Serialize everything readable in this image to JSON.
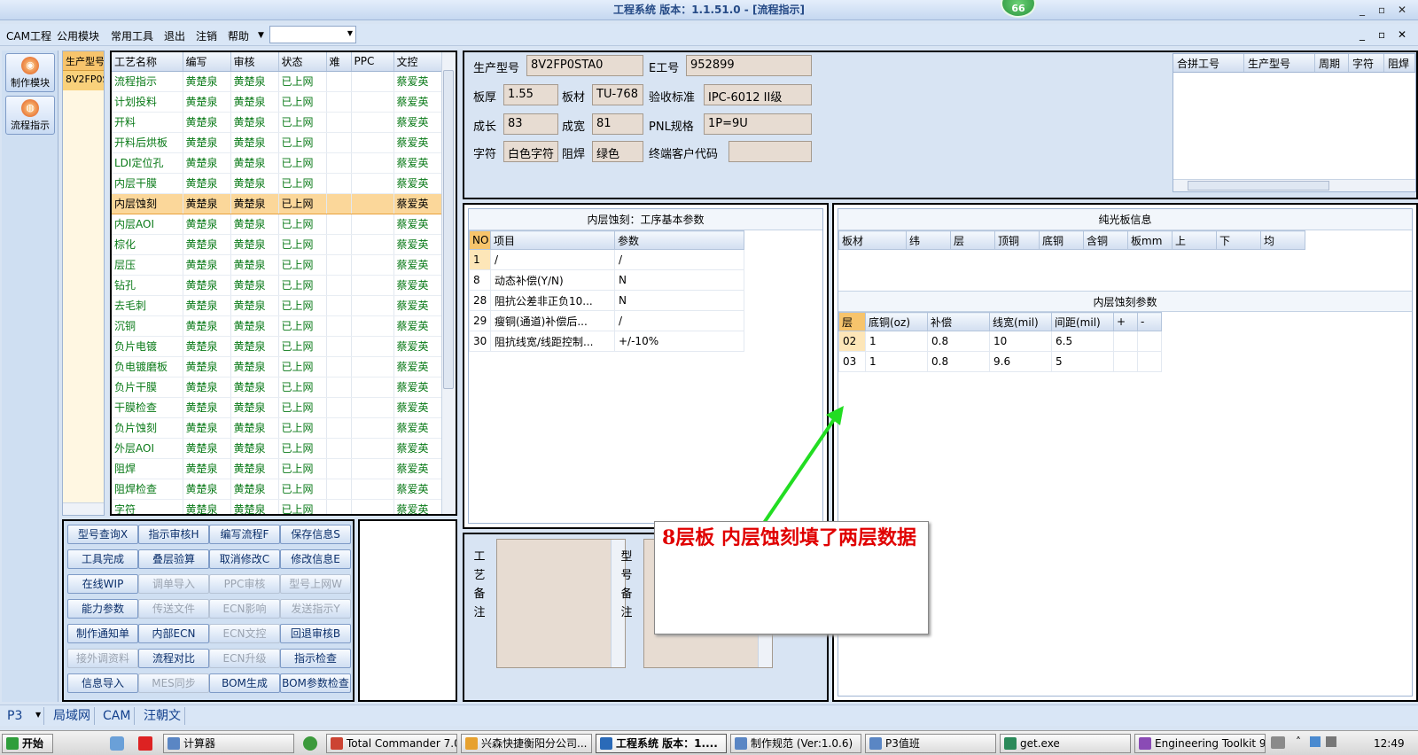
{
  "window": {
    "title": "工程系统   版本：1.1.51.0 - [流程指示]",
    "badge": "66",
    "controls": [
      "_",
      "▫",
      "✕"
    ]
  },
  "menu": {
    "items": [
      "CAM工程",
      "公用模块",
      "常用工具",
      "退出",
      "注销",
      "帮助"
    ],
    "combo_value": ""
  },
  "leftnav": {
    "buttons": [
      "制作模块",
      "流程指示"
    ]
  },
  "model_list": {
    "header": "生产型号",
    "rows": [
      "8V2FP0STA0"
    ]
  },
  "process_grid": {
    "columns": [
      "工艺名称",
      "编写",
      "审核",
      "状态",
      "难",
      "PPC",
      "文控"
    ],
    "rows": [
      [
        "流程指示",
        "黄楚泉",
        "黄楚泉",
        "已上网",
        "",
        "",
        "蔡爱英"
      ],
      [
        "计划投料",
        "黄楚泉",
        "黄楚泉",
        "已上网",
        "",
        "",
        "蔡爱英"
      ],
      [
        "开料",
        "黄楚泉",
        "黄楚泉",
        "已上网",
        "",
        "",
        "蔡爱英"
      ],
      [
        "开料后烘板",
        "黄楚泉",
        "黄楚泉",
        "已上网",
        "",
        "",
        "蔡爱英"
      ],
      [
        "LDI定位孔",
        "黄楚泉",
        "黄楚泉",
        "已上网",
        "",
        "",
        "蔡爱英"
      ],
      [
        "内层干膜",
        "黄楚泉",
        "黄楚泉",
        "已上网",
        "",
        "",
        "蔡爱英"
      ],
      [
        "内层蚀刻",
        "黄楚泉",
        "黄楚泉",
        "已上网",
        "",
        "",
        "蔡爱英"
      ],
      [
        "内层AOI",
        "黄楚泉",
        "黄楚泉",
        "已上网",
        "",
        "",
        "蔡爱英"
      ],
      [
        "棕化",
        "黄楚泉",
        "黄楚泉",
        "已上网",
        "",
        "",
        "蔡爱英"
      ],
      [
        "层压",
        "黄楚泉",
        "黄楚泉",
        "已上网",
        "",
        "",
        "蔡爱英"
      ],
      [
        "钻孔",
        "黄楚泉",
        "黄楚泉",
        "已上网",
        "",
        "",
        "蔡爱英"
      ],
      [
        "去毛刺",
        "黄楚泉",
        "黄楚泉",
        "已上网",
        "",
        "",
        "蔡爱英"
      ],
      [
        "沉铜",
        "黄楚泉",
        "黄楚泉",
        "已上网",
        "",
        "",
        "蔡爱英"
      ],
      [
        "负片电镀",
        "黄楚泉",
        "黄楚泉",
        "已上网",
        "",
        "",
        "蔡爱英"
      ],
      [
        "负电镀磨板",
        "黄楚泉",
        "黄楚泉",
        "已上网",
        "",
        "",
        "蔡爱英"
      ],
      [
        "负片干膜",
        "黄楚泉",
        "黄楚泉",
        "已上网",
        "",
        "",
        "蔡爱英"
      ],
      [
        "干膜检查",
        "黄楚泉",
        "黄楚泉",
        "已上网",
        "",
        "",
        "蔡爱英"
      ],
      [
        "负片蚀刻",
        "黄楚泉",
        "黄楚泉",
        "已上网",
        "",
        "",
        "蔡爱英"
      ],
      [
        "外层AOI",
        "黄楚泉",
        "黄楚泉",
        "已上网",
        "",
        "",
        "蔡爱英"
      ],
      [
        "阻焊",
        "黄楚泉",
        "黄楚泉",
        "已上网",
        "",
        "",
        "蔡爱英"
      ],
      [
        "阻焊检查",
        "黄楚泉",
        "黄楚泉",
        "已上网",
        "",
        "",
        "蔡爱英"
      ],
      [
        "字符",
        "黄楚泉",
        "黄楚泉",
        "已上网",
        "",
        "",
        "蔡爱英"
      ]
    ],
    "selected_row": 6
  },
  "function_buttons": [
    {
      "label": "型号查询X",
      "enabled": true
    },
    {
      "label": "指示审核H",
      "enabled": true
    },
    {
      "label": "编写流程F",
      "enabled": true
    },
    {
      "label": "保存信息S",
      "enabled": true
    },
    {
      "label": "工具完成",
      "enabled": true
    },
    {
      "label": "叠层验算",
      "enabled": true
    },
    {
      "label": "取消修改C",
      "enabled": true
    },
    {
      "label": "修改信息E",
      "enabled": true
    },
    {
      "label": "在线WIP",
      "enabled": true
    },
    {
      "label": "调单导入",
      "enabled": false
    },
    {
      "label": "PPC审核",
      "enabled": false
    },
    {
      "label": "型号上网W",
      "enabled": false
    },
    {
      "label": "能力参数",
      "enabled": true
    },
    {
      "label": "传送文件",
      "enabled": false
    },
    {
      "label": "ECN影响",
      "enabled": false
    },
    {
      "label": "发送指示Y",
      "enabled": false
    },
    {
      "label": "制作通知单",
      "enabled": true
    },
    {
      "label": "内部ECN",
      "enabled": true
    },
    {
      "label": "ECN文控",
      "enabled": false
    },
    {
      "label": "回退审核B",
      "enabled": true
    },
    {
      "label": "接外调资料",
      "enabled": false
    },
    {
      "label": "流程对比",
      "enabled": true
    },
    {
      "label": "ECN升级",
      "enabled": false
    },
    {
      "label": "指示检查",
      "enabled": true
    },
    {
      "label": "信息导入",
      "enabled": true
    },
    {
      "label": "MES同步",
      "enabled": false
    },
    {
      "label": "BOM生成",
      "enabled": true
    },
    {
      "label": "BOM参数检查",
      "enabled": true
    }
  ],
  "header_info": {
    "prod_model_label": "生产型号",
    "prod_model": "8V2FP0STA0",
    "e_no_label": "E工号",
    "e_no": "952899",
    "thickness_label": "板厚",
    "thickness": "1.55",
    "material_label": "板材",
    "material": "TU-768",
    "standard_label": "验收标准",
    "standard": "IPC-6012 II级",
    "length_label": "成长",
    "length": "83",
    "width_label": "成宽",
    "width": "81",
    "pnl_label": "PNL规格",
    "pnl": "1P=9U",
    "char_label": "字符",
    "char": "白色字符",
    "mask_label": "阻焊",
    "mask": "绿色",
    "customer_label": "终端客户代码",
    "customer": ""
  },
  "merge_grid": {
    "columns": [
      "合拼工号",
      "生产型号",
      "周期",
      "字符",
      "阻焊"
    ]
  },
  "basic_params": {
    "title": "内层蚀刻：工序基本参数",
    "columns": [
      "NO",
      "项目",
      "参数"
    ],
    "rows": [
      [
        "1",
        "/",
        "/"
      ],
      [
        "8",
        "动态补偿(Y/N)",
        "N"
      ],
      [
        "28",
        "阻抗公差非正负10...",
        "N"
      ],
      [
        "29",
        "瘦铜(通道)补偿后...",
        "/"
      ],
      [
        "30",
        "阻抗线宽/线距控制...",
        "+/-10%"
      ]
    ]
  },
  "notes": {
    "process_label": "工艺备注",
    "model_label": "型号备注"
  },
  "bare_board": {
    "title": "纯光板信息",
    "columns": [
      "板材",
      "纬",
      "层",
      "顶铜",
      "底铜",
      "含铜",
      "板mm",
      "上",
      "下",
      "均"
    ]
  },
  "inner_etch": {
    "title": "内层蚀刻参数",
    "columns": [
      "层",
      "底铜(oz)",
      "补偿",
      "线宽(mil)",
      "间距(mil)",
      "+",
      "-"
    ],
    "rows": [
      [
        "02",
        "1",
        "0.8",
        "10",
        "6.5",
        "",
        ""
      ],
      [
        "03",
        "1",
        "0.8",
        "9.6",
        "5",
        "",
        ""
      ]
    ]
  },
  "callout": {
    "text": "8层板    内层蚀刻填了两层数据"
  },
  "statusbar": {
    "items": [
      "P3",
      "局域网",
      "CAM",
      "汪朝文"
    ]
  },
  "taskbar": {
    "start": "开始",
    "tasks": [
      "计算器",
      "Total Commander 7.0 ...",
      "兴森快捷衡阳分公司...",
      "工程系统  版本：1....",
      "制作规范 (Ver:1.0.6)",
      "P3值班",
      "get.exe",
      "Engineering Toolkit 9...."
    ],
    "clock": "12:49"
  },
  "colors": {
    "accent": "#f7c46c",
    "selected_row": "#fbd79a",
    "arrow": "#22dd22",
    "callout_text": "#e00000",
    "text_green": "#0a7a18"
  }
}
